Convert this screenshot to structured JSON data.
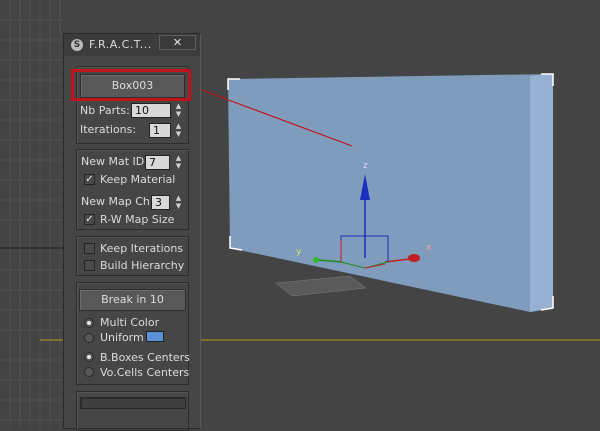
{
  "window": {
    "title": "F.R.A.C.T...",
    "close_label": "✕"
  },
  "object_button": {
    "label": "Box003"
  },
  "params": {
    "nb_parts_label": "Nb Parts:",
    "nb_parts_value": "10",
    "iterations_label": "Iterations:",
    "iterations_value": "1"
  },
  "material": {
    "new_mat_id_label": "New Mat ID:",
    "new_mat_id_value": "7",
    "keep_material_label": "Keep Material",
    "keep_material_checked": true,
    "new_map_ch_label": "New Map Ch:",
    "new_map_ch_value": "3",
    "rw_map_size_label": "R-W Map Size",
    "rw_map_size_checked": true
  },
  "options": {
    "keep_iterations_label": "Keep Iterations",
    "keep_iterations_checked": false,
    "build_hierarchy_label": "Build Hierarchy",
    "build_hierarchy_checked": false
  },
  "break": {
    "button_label": "Break in 10",
    "multi_color_label": "Multi Color",
    "uniform_label": "Uniform",
    "uniform_color": "#5b8fd6",
    "bboxes_label": "B.Boxes Centers",
    "vocells_label": "Vo.Cells Centers"
  },
  "gizmo": {
    "x_label": "x",
    "y_label": "y",
    "z_label": "z"
  },
  "colors": {
    "highlight": "#c0141c",
    "box_face": "#7f9cbd",
    "box_side": "#95b0d0",
    "viewport_bg": "#444444"
  }
}
